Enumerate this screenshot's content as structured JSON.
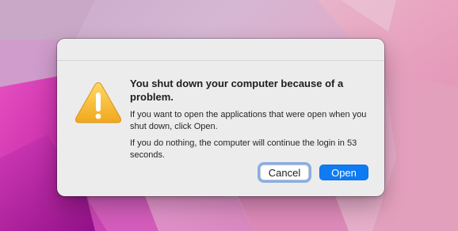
{
  "alert": {
    "title": "You shut down your computer because of a problem.",
    "message_1": "If you want to open the applications that were open when you shut down, click Open.",
    "message_2": "If you do nothing, the computer will continue the login in 53 seconds.",
    "icon": "warning-icon"
  },
  "buttons": {
    "cancel_label": "Cancel",
    "open_label": "Open"
  },
  "colors": {
    "primary_button": "#0f7bf2",
    "focus_ring": "#6399e8",
    "warning_yellow": "#f5b72a"
  }
}
